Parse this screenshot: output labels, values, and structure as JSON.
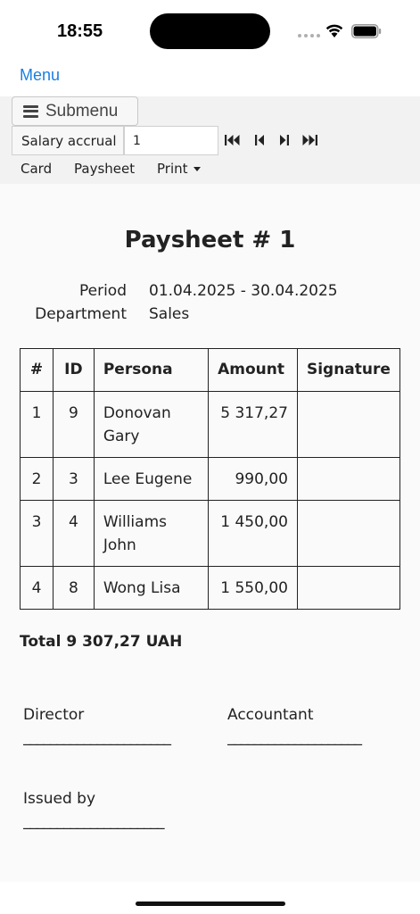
{
  "status_bar": {
    "time": "18:55"
  },
  "menu": {
    "label": "Menu"
  },
  "toolbar": {
    "submenu_label": "Submenu",
    "doc_type": "Salary accrual",
    "doc_number": "1",
    "tabs": {
      "card": "Card",
      "paysheet": "Paysheet",
      "print": "Print"
    }
  },
  "document": {
    "title": "Paysheet # 1",
    "period_label": "Period",
    "period_value": "01.04.2025 - 30.04.2025",
    "department_label": "Department",
    "department_value": "Sales",
    "table": {
      "headers": [
        "#",
        "ID",
        "Persona",
        "Amount",
        "Signature"
      ],
      "rows": [
        {
          "num": "1",
          "id": "9",
          "persona": "Donovan Gary",
          "amount": "5 317,27"
        },
        {
          "num": "2",
          "id": "3",
          "persona": "Lee Eugene",
          "amount": "990,00"
        },
        {
          "num": "3",
          "id": "4",
          "persona": "Williams John",
          "amount": "1 450,00"
        },
        {
          "num": "4",
          "id": "8",
          "persona": "Wong Lisa",
          "amount": "1 550,00"
        }
      ]
    },
    "total": "Total 9 307,27 UAH",
    "director_label": "Director",
    "accountant_label": "Accountant",
    "issued_by_label": "Issued by",
    "signature_line_long": "______________________",
    "signature_line_mid": "____________________",
    "signature_line_short": "_____________________"
  },
  "colors": {
    "accent": "#1a7fe0",
    "text": "#222222",
    "toolbar_bg": "#f2f2f2"
  }
}
